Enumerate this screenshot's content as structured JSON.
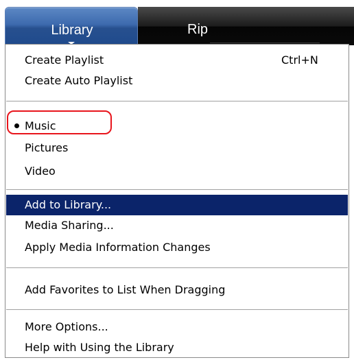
{
  "tabs": {
    "library": "Library",
    "rip": "Rip"
  },
  "menu": {
    "group1": [
      {
        "label": "Create Playlist",
        "shortcut": "Ctrl+N"
      },
      {
        "label": "Create Auto Playlist"
      }
    ],
    "group2": [
      {
        "label": "Music",
        "selected": true
      },
      {
        "label": "Pictures"
      },
      {
        "label": "Video"
      }
    ],
    "group3": [
      {
        "label": "Add to Library...",
        "highlighted": true
      },
      {
        "label": "Media Sharing..."
      },
      {
        "label": "Apply Media Information Changes"
      }
    ],
    "group4": [
      {
        "label": "Add Favorites to List When Dragging"
      }
    ],
    "group5": [
      {
        "label": "More Options..."
      },
      {
        "label": "Help with Using the Library"
      }
    ]
  },
  "colors": {
    "highlight_bg": "#0b246a",
    "annotation": "#e8141b",
    "library_tab": "#2a5aa0"
  }
}
